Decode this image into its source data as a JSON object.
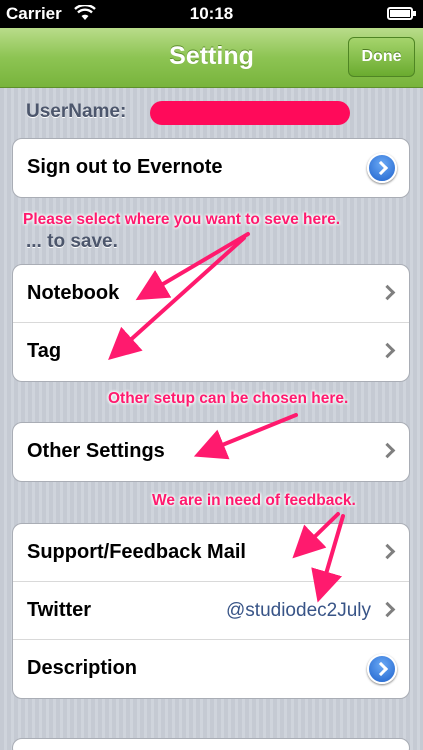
{
  "status_bar": {
    "carrier": "Carrier",
    "time": "10:18"
  },
  "navbar": {
    "title": "Setting",
    "done_label": "Done"
  },
  "username": {
    "label": "UserName:"
  },
  "groups": {
    "account": {
      "signout_label": "Sign out to Evernote"
    },
    "save": {
      "header": "... to save.",
      "notebook_label": "Notebook",
      "tag_label": "Tag"
    },
    "other": {
      "other_settings_label": "Other Settings"
    },
    "info": {
      "support_label": "Support/Feedback Mail",
      "twitter_label": "Twitter",
      "twitter_value": "@studiodec2July",
      "description_label": "Description"
    }
  },
  "annotations": {
    "save_note": "Please select where you want to seve here.",
    "other_note": "Other setup can be chosen here.",
    "feedback_note": "We are in need of feedback."
  },
  "colors": {
    "nav_green": "#8dc453",
    "annotation_pink": "#ff1a6e",
    "value_blue": "#385487"
  }
}
